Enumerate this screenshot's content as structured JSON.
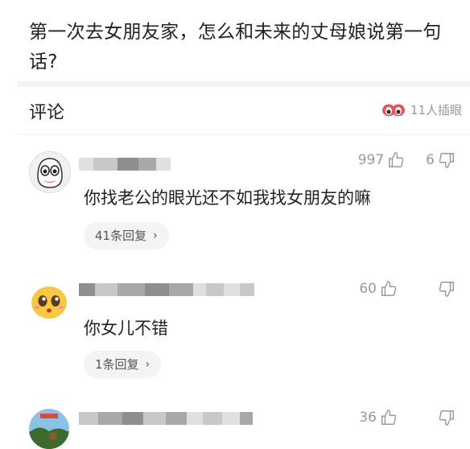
{
  "question": {
    "title": "第一次去女朋友家，怎么和未来的丈母娘说第一句话?"
  },
  "comments_header": {
    "title": "评论",
    "viewers_label": "11人插眼"
  },
  "comments": [
    {
      "likes": "997",
      "dislikes": "6",
      "text": "你找老公的眼光还不如我找女朋友的嘛",
      "reply_label": "41条回复",
      "avatar_icon": "ghost-face-avatar"
    },
    {
      "likes": "60",
      "dislikes": "",
      "text": "你女儿不错",
      "reply_label": "1条回复",
      "avatar_icon": "cute-emoji-avatar"
    },
    {
      "likes": "36",
      "dislikes": "",
      "text": "",
      "reply_label": "",
      "avatar_icon": "landscape-photo-avatar"
    }
  ],
  "colors": {
    "text": "#222222",
    "muted": "#999999",
    "pill_bg": "#f4f4f4",
    "divider": "#f3f3f3"
  },
  "icons": {
    "like": "thumbs-up-icon",
    "dislike": "thumbs-down-icon",
    "viewers": "eyes-icon",
    "chevron": "chevron-right-icon"
  }
}
